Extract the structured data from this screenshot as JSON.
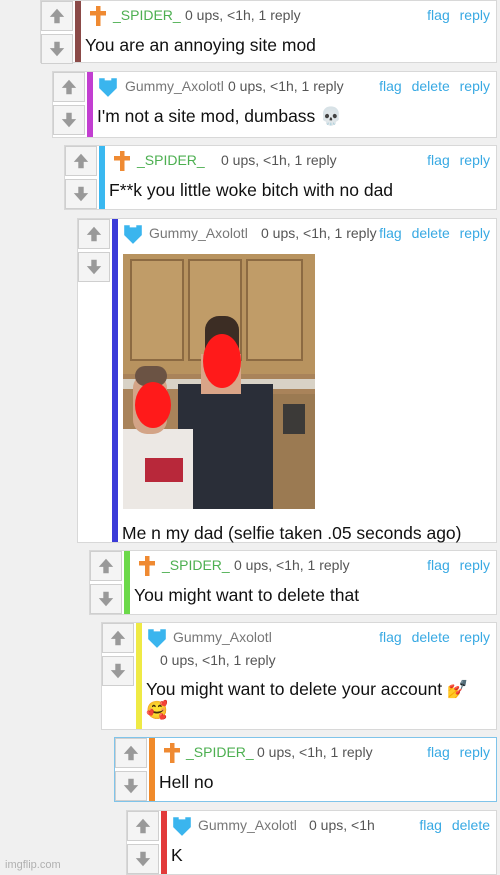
{
  "colors": {
    "link": "#38a9e3",
    "spider_name": "#4caf50",
    "gummy_name": "#777777",
    "bar_c1": "#8b4a48",
    "bar_c2": "#c23ed1",
    "bar_c3": "#3ab8f0",
    "bar_c4": "#3b3bd8",
    "bar_c5": "#6cd94a",
    "bar_c6": "#efea45",
    "bar_c7": "#f08a2a",
    "bar_c8": "#e23a3a"
  },
  "icons": {
    "spider_avatar": "cross-icon",
    "gummy_avatar": "heart-icon",
    "upvote": "arrow-up-icon",
    "downvote": "arrow-down-icon",
    "photo": "selfie-photo"
  },
  "comments": [
    {
      "user": "_SPIDER_",
      "meta": "0 ups, <1h, 1 reply",
      "actions": [
        "flag",
        "reply"
      ],
      "text": "You are an annoying site mod"
    },
    {
      "user": "Gummy_Axolotl",
      "meta": "0 ups, <1h, 1 reply",
      "actions": [
        "flag",
        "delete",
        "reply"
      ],
      "text": "I'm not a site mod, dumbass 💀"
    },
    {
      "user": "_SPIDER_",
      "meta": "0 ups, <1h, 1 reply",
      "actions": [
        "flag",
        "reply"
      ],
      "text": "F**k you little woke bitch with no dad"
    },
    {
      "user": "Gummy_Axolotl",
      "meta": "0 ups, <1h, 1 reply",
      "actions": [
        "flag",
        "delete",
        "reply"
      ],
      "text": "Me n my dad (selfie taken .05 seconds ago)"
    },
    {
      "user": "_SPIDER_",
      "meta": "0 ups, <1h, 1 reply",
      "actions": [
        "flag",
        "reply"
      ],
      "text": "You might want to delete that"
    },
    {
      "user": "Gummy_Axolotl",
      "meta": "0 ups, <1h, 1 reply",
      "actions": [
        "flag",
        "delete",
        "reply"
      ],
      "text_line1": "You might want to delete your account 💅",
      "text_line2": "🥰"
    },
    {
      "user": "_SPIDER_",
      "meta": "0 ups, <1h, 1 reply",
      "actions": [
        "flag",
        "reply"
      ],
      "text": "Hell no"
    },
    {
      "user": "Gummy_Axolotl",
      "meta": "0 ups, <1h",
      "actions": [
        "flag",
        "delete"
      ],
      "text": "K"
    }
  ],
  "watermark": "imgflip.com"
}
